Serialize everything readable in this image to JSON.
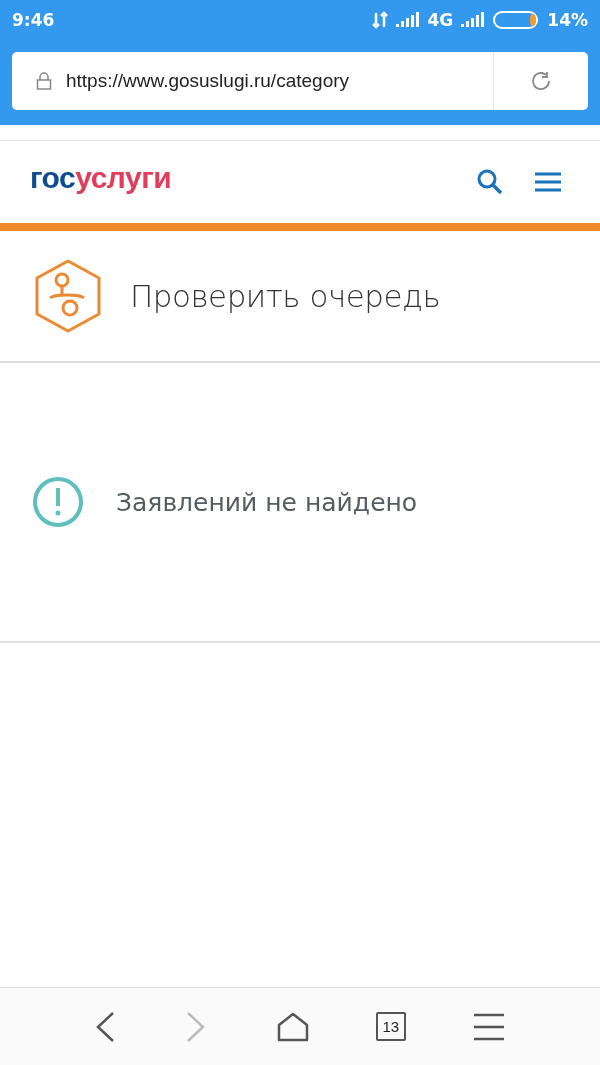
{
  "status_bar": {
    "time": "9:46",
    "network": "4G",
    "battery": {
      "level": 0.14,
      "percent": "14%"
    }
  },
  "address_bar": {
    "url": "https://www.gosuslugi.ru/category"
  },
  "header": {
    "logo": {
      "part_1": "гос",
      "part_2": "услуги"
    }
  },
  "page": {
    "title": "Проверить очередь",
    "message": "Заявлений не найдено"
  },
  "bottom_nav": {
    "back_disabled": false,
    "forward_disabled": true,
    "tabs_count": "13"
  }
}
